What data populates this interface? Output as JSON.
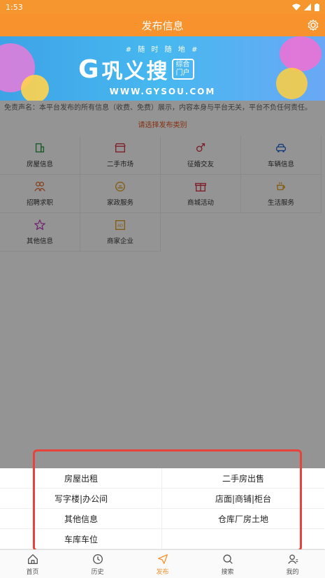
{
  "status": {
    "time": "1:53"
  },
  "header": {
    "title": "发布信息",
    "settings_icon": "gear-icon"
  },
  "banner": {
    "slogan": "# 随 时 随 地 #",
    "brand": "巩义搜",
    "brand_sub": "综合门户",
    "url": "WWW.GYSOU.COM"
  },
  "disclaimer": "免责声名：本平台发布的所有信息（收费、免费）展示，内容本身与平台无关，平台不负任何责任。",
  "prompt": "请选择发布类别",
  "categories": [
    {
      "label": "房屋信息",
      "icon": "building-icon",
      "color": "#2e9c45"
    },
    {
      "label": "二手市场",
      "icon": "shop-icon",
      "color": "#d8364a"
    },
    {
      "label": "征婚交友",
      "icon": "gender-icon",
      "color": "#d8364a"
    },
    {
      "label": "车辆信息",
      "icon": "car-icon",
      "color": "#2c6bd3"
    },
    {
      "label": "招聘求职",
      "icon": "people-icon",
      "color": "#e8743a"
    },
    {
      "label": "家政服务",
      "icon": "service-icon",
      "color": "#e0a020"
    },
    {
      "label": "商城活动",
      "icon": "gift-icon",
      "color": "#d8364a"
    },
    {
      "label": "生活服务",
      "icon": "coffee-icon",
      "color": "#e0a020"
    },
    {
      "label": "其他信息",
      "icon": "star-icon",
      "color": "#c03fbf"
    },
    {
      "label": "商家企业",
      "icon": "ad-icon",
      "color": "#e0a020"
    }
  ],
  "sheet": {
    "options": [
      "房屋出租",
      "二手房出售",
      "写字楼|办公间",
      "店面|商铺|柜台",
      "其他信息",
      "仓库厂房土地",
      "车库车位",
      ""
    ]
  },
  "tabbar": [
    {
      "label": "首页",
      "icon": "home-icon"
    },
    {
      "label": "历史",
      "icon": "clock-icon"
    },
    {
      "label": "发布",
      "icon": "send-icon",
      "active": true
    },
    {
      "label": "搜索",
      "icon": "search-icon"
    },
    {
      "label": "我的",
      "icon": "user-icon"
    }
  ],
  "colors": {
    "accent": "#f7922c",
    "highlight": "#e8433a"
  }
}
